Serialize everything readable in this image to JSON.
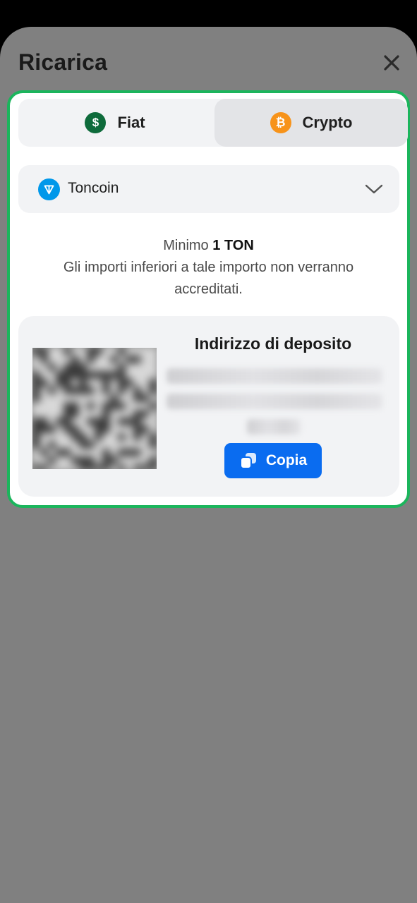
{
  "sheet": {
    "title": "Ricarica",
    "close_icon": "close-icon"
  },
  "tabs": [
    {
      "label": "Fiat",
      "icon": "dollar-icon",
      "icon_glyph": "$",
      "selected": false
    },
    {
      "label": "Crypto",
      "icon": "bitcoin-icon",
      "icon_glyph": "₿",
      "selected": true
    }
  ],
  "currency_selector": {
    "value": "Toncoin",
    "icon": "toncoin-icon"
  },
  "minimum": {
    "prefix": "Minimo",
    "amount": "1 TON",
    "note": "Gli importi inferiori a tale importo non verranno accreditati."
  },
  "deposit": {
    "title": "Indirizzo di deposito",
    "copy_label": "Copia",
    "copy_icon": "copy-icon"
  },
  "colors": {
    "accent": "#0a6cf0",
    "highlight_border": "#1bb55c",
    "fiat_icon": "#0e6b3b",
    "bitcoin_icon": "#f7931a",
    "ton_icon": "#0098ea",
    "overlay": "#808080"
  }
}
